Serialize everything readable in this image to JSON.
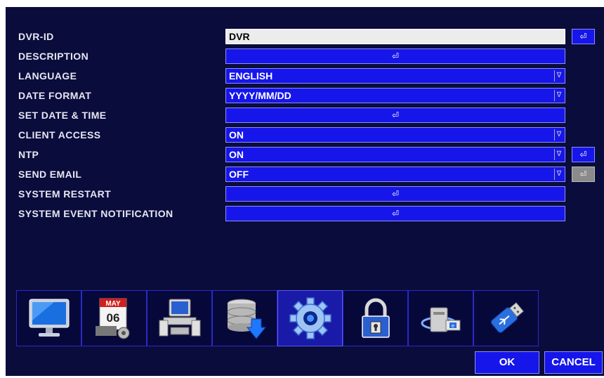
{
  "settings": {
    "rows": [
      {
        "label": "DVR-ID",
        "value": "DVR"
      },
      {
        "label": "DESCRIPTION",
        "value": "⏎"
      },
      {
        "label": "LANGUAGE",
        "value": "ENGLISH"
      },
      {
        "label": "DATE FORMAT",
        "value": "YYYY/MM/DD"
      },
      {
        "label": "SET DATE & TIME",
        "value": "⏎"
      },
      {
        "label": "CLIENT ACCESS",
        "value": "ON"
      },
      {
        "label": "NTP",
        "value": "ON"
      },
      {
        "label": "SEND EMAIL",
        "value": "OFF"
      },
      {
        "label": "SYSTEM RESTART",
        "value": "⏎"
      },
      {
        "label": "SYSTEM EVENT NOTIFICATION",
        "value": "⏎"
      }
    ],
    "side_buttons": {
      "dvr_id": "⏎",
      "ntp": "⏎",
      "send_email": "⏎"
    },
    "dropdown_glyph": "∇"
  },
  "calendar_icon": {
    "month": "MAY",
    "day": "06"
  },
  "icons": [
    "monitor-icon",
    "calendar-icon",
    "computer-icon",
    "database-download-icon",
    "gear-icon",
    "padlock-icon",
    "network-icon",
    "usb-drive-icon"
  ],
  "buttons": {
    "ok": "OK",
    "cancel": "CANCEL"
  },
  "colors": {
    "panel": "#0a0c3c",
    "field": "#1616ea",
    "field_border": "#8e8ef8",
    "text": "#e6e6f2"
  }
}
